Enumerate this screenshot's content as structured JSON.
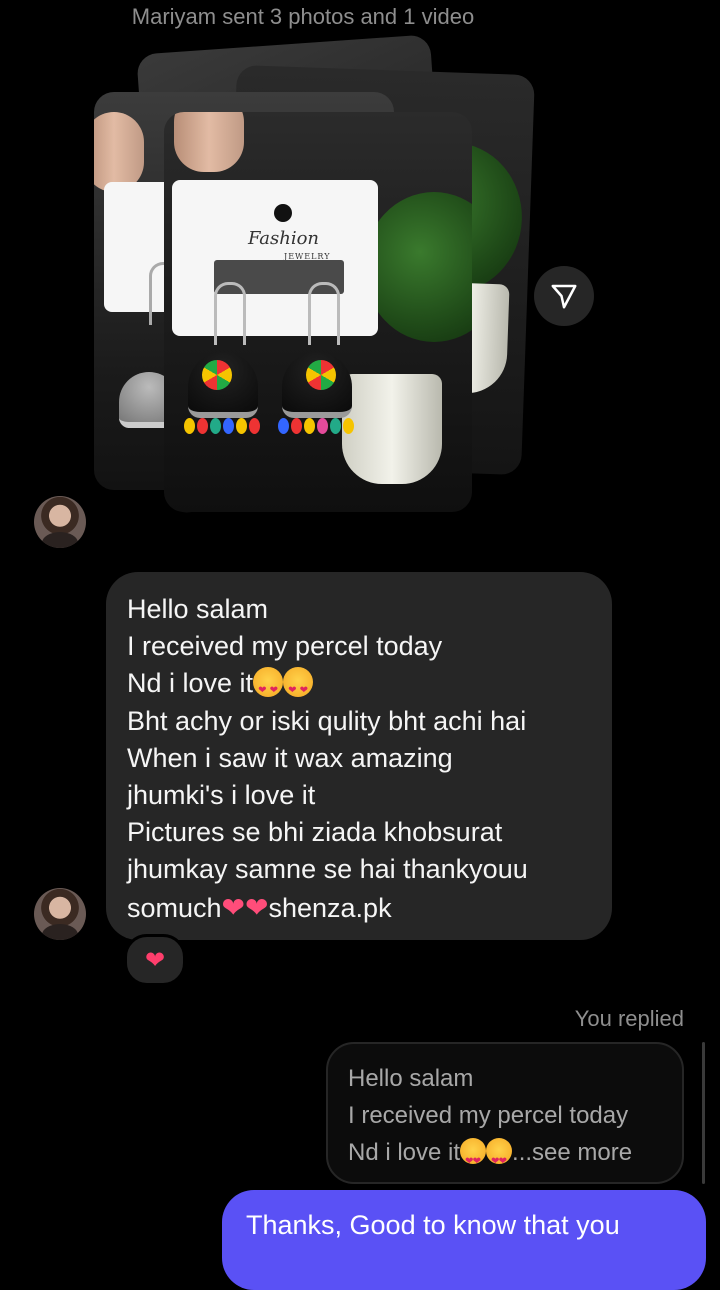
{
  "thread": {
    "media_notice": "Mariyam sent 3 photos and 1 video",
    "photo_stack": {
      "brand_name": "Fashion",
      "brand_sub": "JEWELRY",
      "share_icon": "send-icon"
    },
    "incoming_message": {
      "lines": [
        "Hello salam",
        "I received my percel today",
        "Nd i love it",
        "Bht achy or iski qulity bht achi hai",
        "When i saw it wax amazing",
        "jhumki's i love it",
        "Pictures se bhi ziada khobsurat",
        "jhumkay samne se hai thankyouu",
        "somuch",
        "shenza.pk"
      ],
      "reaction": "heart"
    },
    "reply": {
      "label": "You replied",
      "quoted_lines": [
        "Hello salam",
        "I received my percel today",
        "Nd i love it",
        "...see more"
      ],
      "outgoing_text": "Thanks, Good to know that you"
    }
  },
  "colors": {
    "background": "#000000",
    "bubble_incoming": "#262626",
    "bubble_outgoing": "#5a51f5",
    "muted_text": "#8e8e8e",
    "heart": "#ff3e6c"
  }
}
